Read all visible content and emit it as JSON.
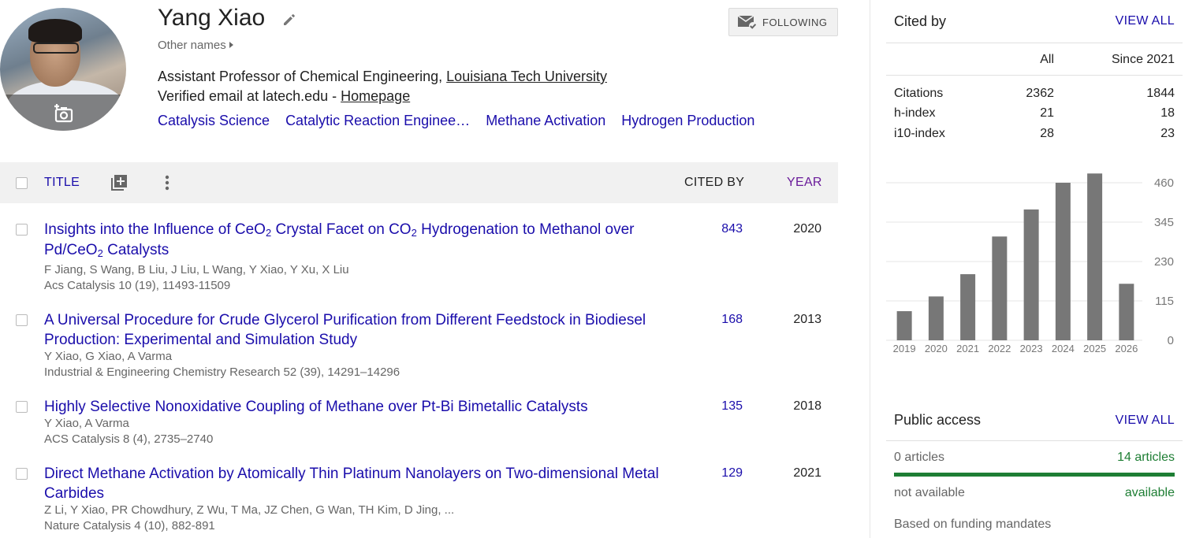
{
  "profile": {
    "name": "Yang Xiao",
    "other_names": "Other names",
    "affiliation_prefix": "Assistant Professor of Chemical Engineering, ",
    "affiliation_link": "Louisiana Tech University",
    "verified_prefix": "Verified email at latech.edu - ",
    "homepage_link": "Homepage",
    "interests": [
      "Catalysis Science",
      "Catalytic Reaction Enginee…",
      "Methane Activation",
      "Hydrogen Production"
    ],
    "follow_label": "FOLLOWING"
  },
  "table": {
    "title_label": "TITLE",
    "cited_by_label": "CITED BY",
    "year_label": "YEAR"
  },
  "articles": [
    {
      "title_parts": [
        "Insights into the Influence of CeO",
        "2",
        " Crystal Facet on CO",
        "2",
        " Hydrogenation to Methanol over Pd/CeO",
        "2",
        " Catalysts"
      ],
      "authors": "F Jiang, S Wang, B Liu, J Liu, L Wang, Y Xiao, Y Xu, X Liu",
      "venue": "Acs Catalysis 10 (19), 11493-11509",
      "cited_by": "843",
      "year": "2020"
    },
    {
      "title_parts": [
        "A Universal Procedure for Crude Glycerol Purification from Different Feedstock in Biodiesel Production: Experimental and Simulation Study"
      ],
      "authors": "Y Xiao, G Xiao, A Varma",
      "venue": "Industrial & Engineering Chemistry Research 52 (39), 14291–14296",
      "cited_by": "168",
      "year": "2013"
    },
    {
      "title_parts": [
        "Highly Selective Nonoxidative Coupling of Methane over Pt-Bi Bimetallic Catalysts"
      ],
      "authors": "Y Xiao, A Varma",
      "venue": "ACS Catalysis 8 (4), 2735–2740",
      "cited_by": "135",
      "year": "2018"
    },
    {
      "title_parts": [
        "Direct Methane Activation by Atomically Thin Platinum Nanolayers on Two-dimensional Metal Carbides"
      ],
      "authors": "Z Li, Y Xiao, PR Chowdhury, Z Wu, T Ma, JZ Chen, G Wan, TH Kim, D Jing, ...",
      "venue": "Nature Catalysis 4 (10), 882-891",
      "cited_by": "129",
      "year": "2021"
    }
  ],
  "cited_by": {
    "heading": "Cited by",
    "view_all": "VIEW ALL",
    "col_all": "All",
    "col_since": "Since 2021",
    "rows": [
      {
        "label": "Citations",
        "all": "2362",
        "since": "1844"
      },
      {
        "label": "h-index",
        "all": "21",
        "since": "18"
      },
      {
        "label": "i10-index",
        "all": "28",
        "since": "23"
      }
    ]
  },
  "chart_data": {
    "type": "bar",
    "categories": [
      "2019",
      "2020",
      "2021",
      "2022",
      "2023",
      "2024",
      "2025",
      "2026"
    ],
    "values": [
      85,
      128,
      193,
      303,
      382,
      460,
      487,
      165
    ],
    "yticks": [
      0,
      115,
      230,
      345,
      460
    ],
    "ylim": [
      0,
      500
    ],
    "bar_color": "#777777",
    "grid": true
  },
  "public_access": {
    "heading": "Public access",
    "view_all": "VIEW ALL",
    "unavailable_count": "0 articles",
    "available_count": "14 articles",
    "available_fraction": 1.0,
    "unavailable_label": "not available",
    "available_label": "available",
    "mandates": "Based on funding mandates"
  },
  "colors": {
    "link": "#1a0dab",
    "accent_green": "#1e7e34",
    "year_purple": "#6a1b9a"
  }
}
